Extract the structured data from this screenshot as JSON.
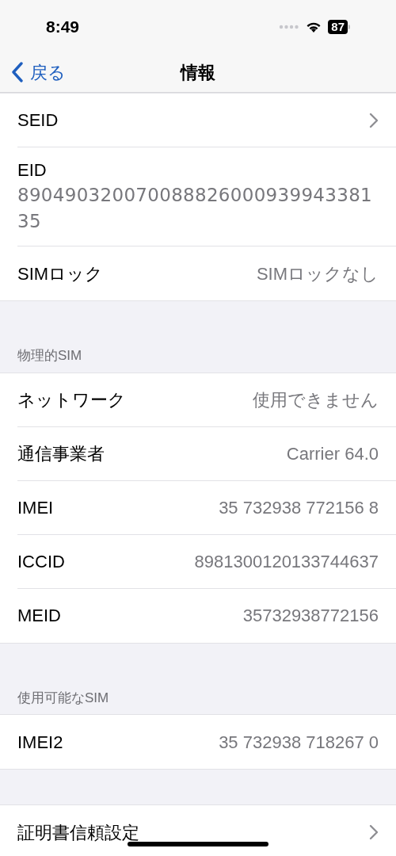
{
  "status_bar": {
    "time": "8:49",
    "battery": "87"
  },
  "nav": {
    "back": "戻る",
    "title": "情報"
  },
  "sections": [
    {
      "rows": [
        {
          "kind": "chevron",
          "label": "SEID"
        },
        {
          "kind": "stacked",
          "label": "EID",
          "value": "89049032007008882600093994338135"
        },
        {
          "kind": "value",
          "label": "SIMロック",
          "value": "SIMロックなし"
        }
      ]
    },
    {
      "header": "物理的SIM",
      "rows": [
        {
          "kind": "value",
          "label": "ネットワーク",
          "value": "使用できません"
        },
        {
          "kind": "value",
          "label": "通信事業者",
          "value": "Carrier 64.0"
        },
        {
          "kind": "value",
          "label": "IMEI",
          "value": "35 732938 772156 8"
        },
        {
          "kind": "value",
          "label": "ICCID",
          "value": "8981300120133744637"
        },
        {
          "kind": "value",
          "label": "MEID",
          "value": "35732938772156"
        }
      ]
    },
    {
      "header": "使用可能なSIM",
      "rows": [
        {
          "kind": "value",
          "label": "IMEI2",
          "value": "35 732938 718267 0"
        }
      ]
    },
    {
      "rows": [
        {
          "kind": "chevron",
          "label": "証明書信頼設定"
        }
      ]
    }
  ]
}
